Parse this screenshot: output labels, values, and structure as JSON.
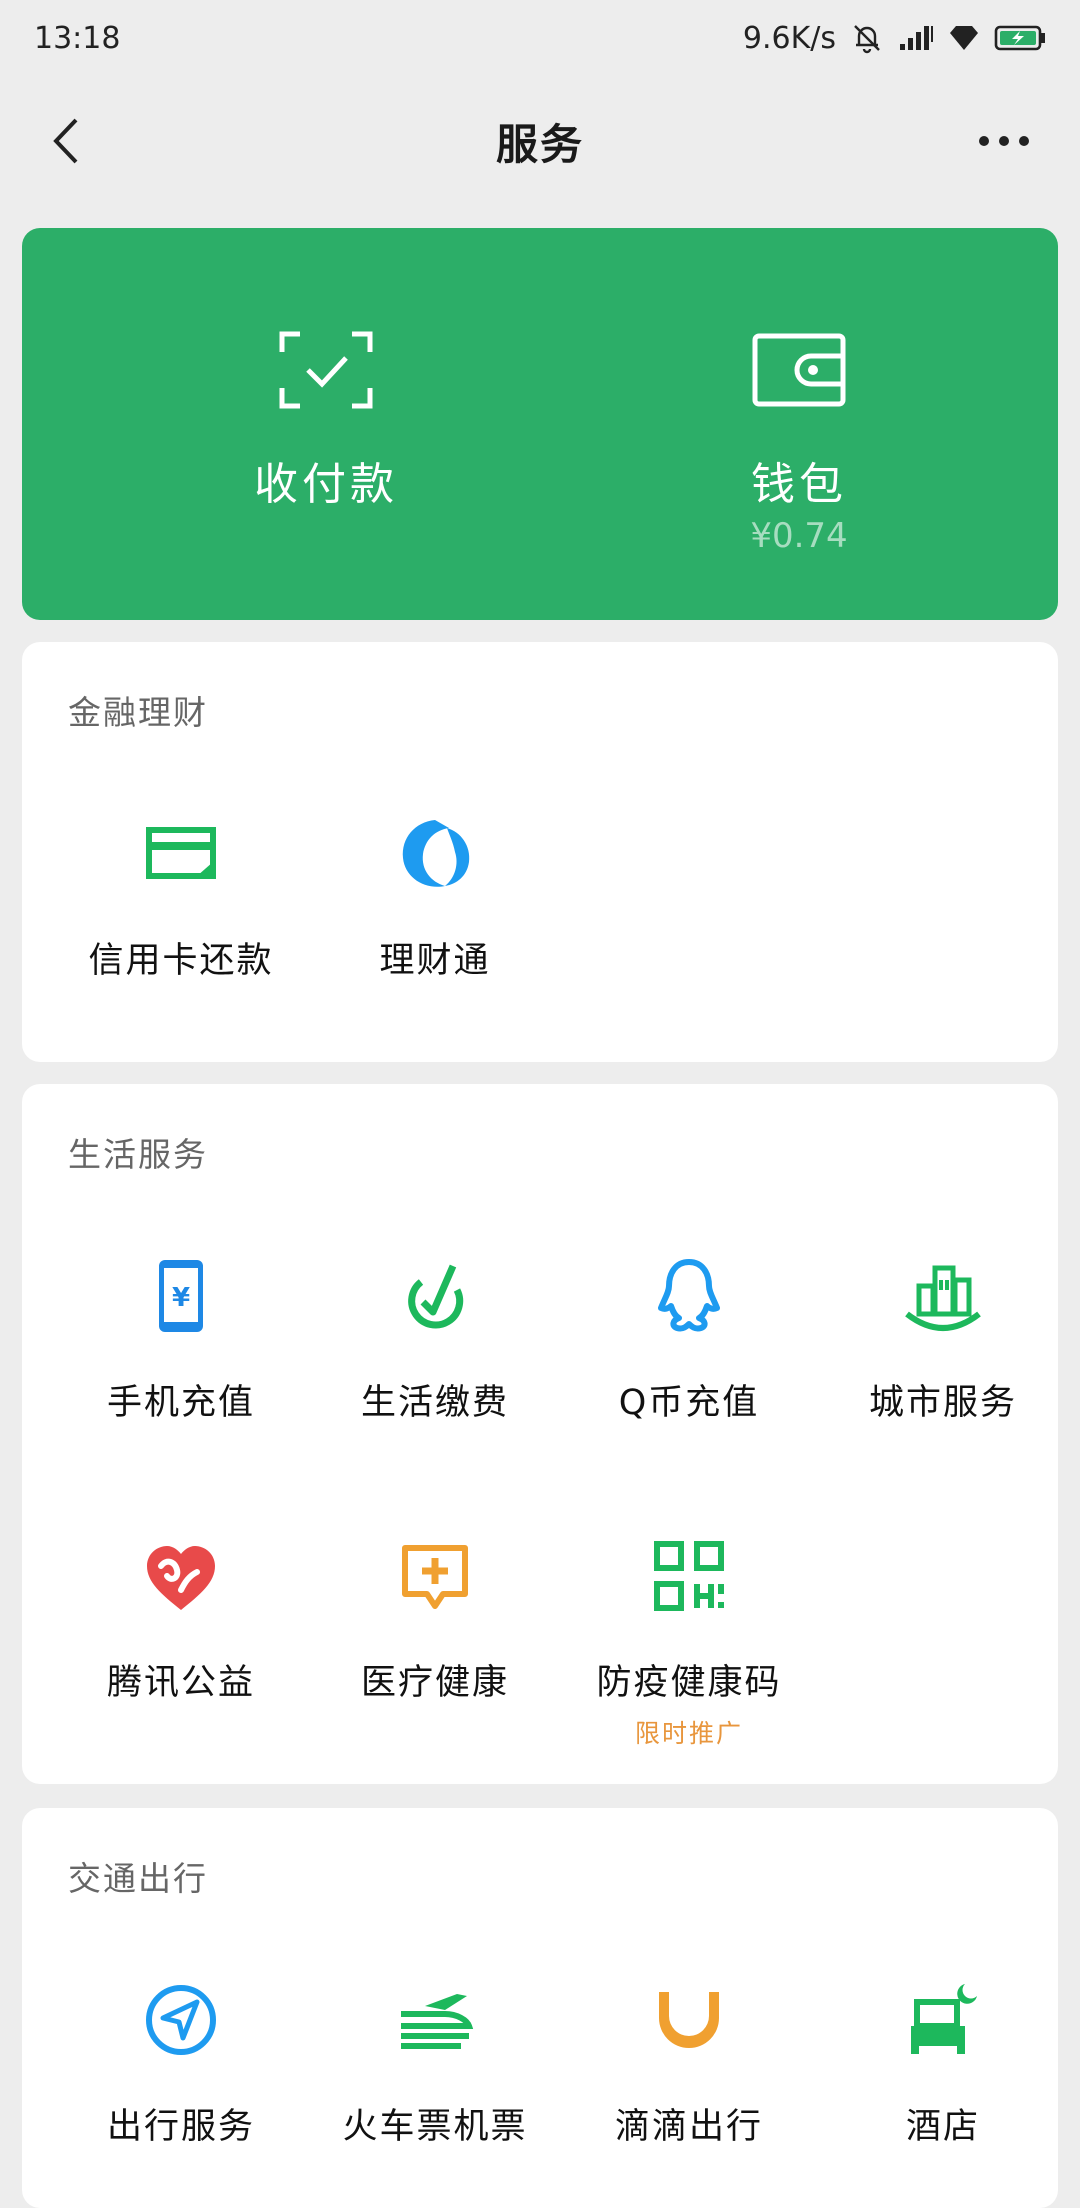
{
  "status": {
    "time": "13:18",
    "speed": "9.6K/s"
  },
  "nav": {
    "title": "服务"
  },
  "wallet": {
    "pay_label": "收付款",
    "wallet_label": "钱包",
    "balance": "¥0.74"
  },
  "sections": {
    "finance": {
      "title": "金融理财",
      "items": [
        {
          "label": "信用卡还款",
          "icon": "credit-card-icon"
        },
        {
          "label": "理财通",
          "icon": "licaitong-icon"
        }
      ]
    },
    "life": {
      "title": "生活服务",
      "items": [
        {
          "label": "手机充值",
          "icon": "phone-recharge-icon"
        },
        {
          "label": "生活缴费",
          "icon": "bill-payment-icon"
        },
        {
          "label": "Q币充值",
          "icon": "qq-coin-icon"
        },
        {
          "label": "城市服务",
          "icon": "city-service-icon"
        },
        {
          "label": "腾讯公益",
          "icon": "charity-heart-icon"
        },
        {
          "label": "医疗健康",
          "icon": "medical-icon"
        },
        {
          "label": "防疫健康码",
          "icon": "qr-code-icon",
          "promo": "限时推广"
        }
      ]
    },
    "transport": {
      "title": "交通出行",
      "items": [
        {
          "label": "出行服务",
          "icon": "navigation-icon"
        },
        {
          "label": "火车票机票",
          "icon": "train-plane-icon"
        },
        {
          "label": "滴滴出行",
          "icon": "didi-icon"
        },
        {
          "label": "酒店",
          "icon": "hotel-bed-icon"
        }
      ]
    }
  },
  "colors": {
    "wallet_green": "#2cae68",
    "icon_green": "#1db85c",
    "icon_blue": "#1e9bf0",
    "icon_orange": "#f0a030",
    "icon_red": "#e84a4a",
    "promo_orange": "#e8963d"
  }
}
